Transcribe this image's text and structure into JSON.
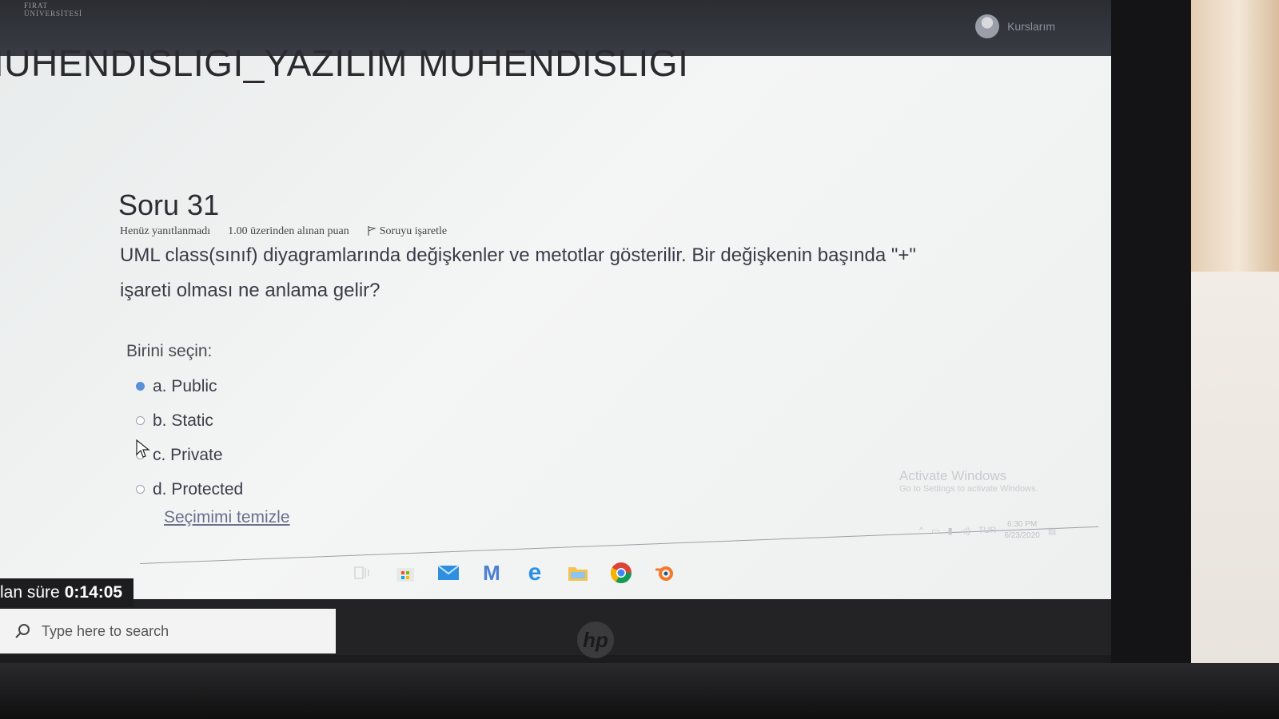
{
  "app": {
    "logo_lines": [
      "FIRAT",
      "ÜNİVERSİTESİ"
    ],
    "user_name": "Kurslarım"
  },
  "course": {
    "title": "IUHENDISLIGI_YAZILIM MUHENDISLIGI"
  },
  "question": {
    "title": "Soru 31",
    "status": "Henüz yanıtlanmadı",
    "grade": "1.00 üzerinden alınan puan",
    "flag_label": "Soruyu işaretle",
    "text": "UML class(sınıf) diyagramlarında değişkenler ve metotlar gösterilir. Bir değişkenin başında \"+\" işareti olması ne anlama gelir?",
    "choose_label": "Birini seçin:",
    "answers": [
      {
        "label": "a. Public",
        "selected": true
      },
      {
        "label": "b. Static",
        "selected": false
      },
      {
        "label": "c. Private",
        "selected": false
      },
      {
        "label": "d. Protected",
        "selected": false
      }
    ],
    "clear_label": "Seçimimi temizle"
  },
  "timer": {
    "label": "lan süre",
    "value": "0:14:05"
  },
  "windows": {
    "watermark_title": "Activate Windows",
    "watermark_sub": "Go to Settings to activate Windows.",
    "search_placeholder": "Type here to search",
    "tray_lang": "TUR",
    "clock_time": "6:30 PM",
    "clock_date": "6/23/2020",
    "taskbar_icons": [
      "task-view-icon",
      "store-icon",
      "mail-icon",
      "m-app-icon",
      "edge-icon",
      "file-explorer-icon",
      "chrome-icon",
      "blender-icon"
    ]
  },
  "colors": {
    "accent": "#5b8fd8",
    "topbar": "#2b2d33",
    "page_bg": "#eef0f0"
  }
}
